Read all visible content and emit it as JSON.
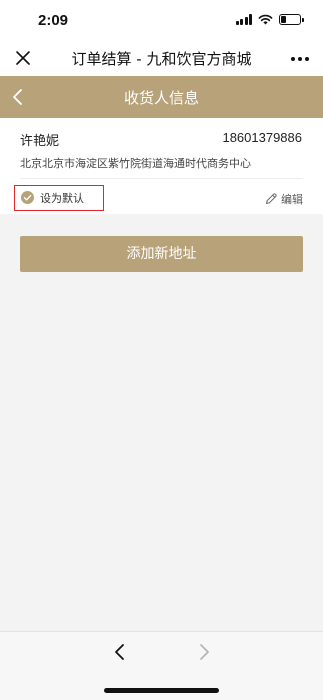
{
  "status_bar": {
    "time": "2:09",
    "battery_level": 0.3
  },
  "title_bar": {
    "title": "订单结算 - 九和饮官方商城",
    "close_icon": "close-icon",
    "more_icon": "more-icon"
  },
  "page_header": {
    "title": "收货人信息",
    "back_icon": "chevron-left-icon"
  },
  "address": {
    "name": "许艳妮",
    "phone": "18601379886",
    "detail": "北京北京市海淀区紫竹院街道海通时代商务中心",
    "default_label": "设为默认",
    "default_checked": true,
    "edit_label": "编辑"
  },
  "add_address_button": "添加新地址",
  "bottom_nav": {
    "back_icon": "chevron-left-icon",
    "forward_icon": "chevron-right-icon"
  },
  "colors": {
    "accent": "#b8a27a",
    "highlight_border": "#e3262b",
    "background": "#f3f3f3"
  }
}
